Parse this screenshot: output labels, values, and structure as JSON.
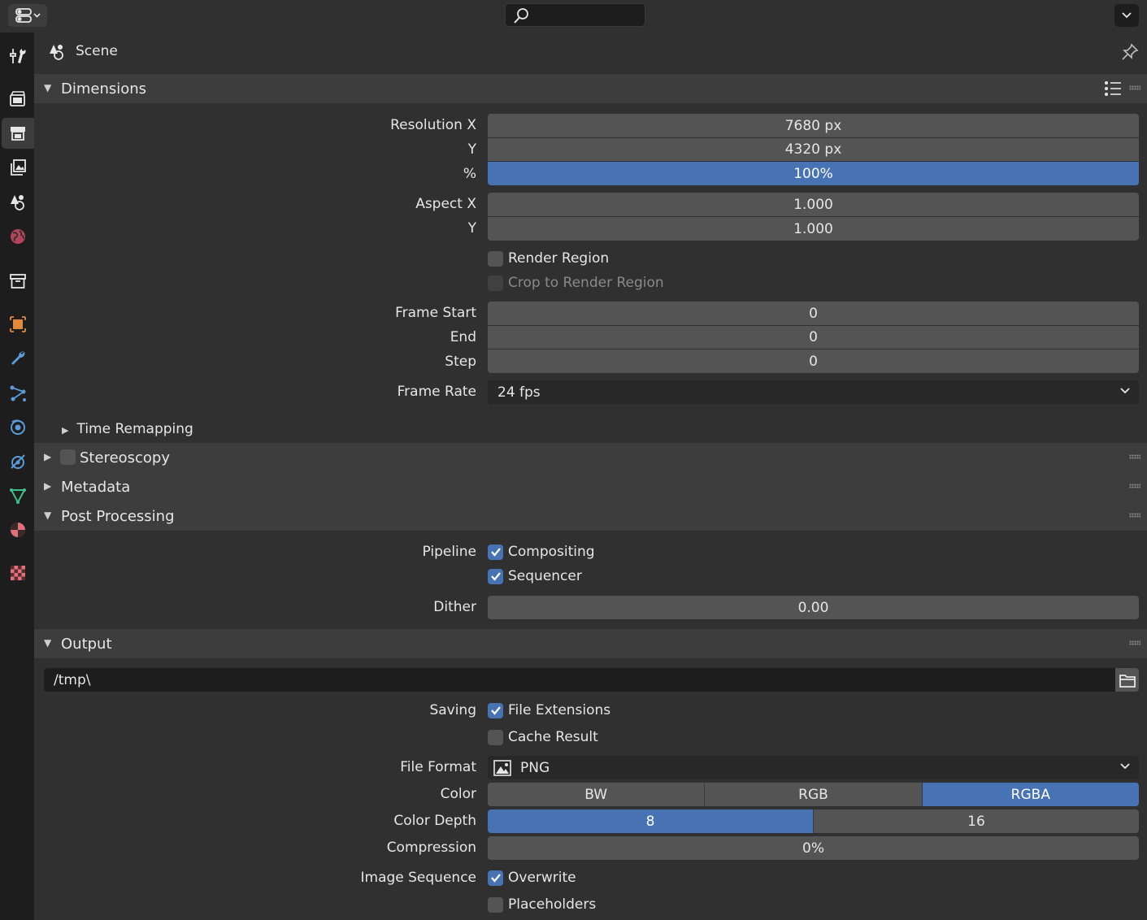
{
  "context": {
    "label": "Scene"
  },
  "panels": {
    "dimensions": {
      "title": "Dimensions",
      "resolution_x_label": "Resolution X",
      "resolution_x": "7680 px",
      "resolution_y_label": "Y",
      "resolution_y": "4320 px",
      "percent_label": "%",
      "percent": "100%",
      "aspect_x_label": "Aspect X",
      "aspect_x": "1.000",
      "aspect_y_label": "Y",
      "aspect_y": "1.000",
      "render_region": "Render Region",
      "crop_region": "Crop to Render Region",
      "frame_start_label": "Frame Start",
      "frame_start": "0",
      "frame_end_label": "End",
      "frame_end": "0",
      "frame_step_label": "Step",
      "frame_step": "0",
      "frame_rate_label": "Frame Rate",
      "frame_rate": "24 fps",
      "time_remapping": "Time Remapping"
    },
    "stereoscopy": {
      "title": "Stereoscopy"
    },
    "metadata": {
      "title": "Metadata"
    },
    "post_processing": {
      "title": "Post Processing",
      "pipeline_label": "Pipeline",
      "compositing": "Compositing",
      "sequencer": "Sequencer",
      "dither_label": "Dither",
      "dither": "0.00"
    },
    "output": {
      "title": "Output",
      "path": "/tmp\\",
      "saving_label": "Saving",
      "file_extensions": "File Extensions",
      "cache_result": "Cache Result",
      "file_format_label": "File Format",
      "file_format": "PNG",
      "color_label": "Color",
      "color_options": [
        "BW",
        "RGB",
        "RGBA"
      ],
      "color_depth_label": "Color Depth",
      "color_depth_options": [
        "8",
        "16"
      ],
      "compression_label": "Compression",
      "compression": "0%",
      "image_sequence_label": "Image Sequence",
      "overwrite": "Overwrite",
      "placeholders": "Placeholders"
    }
  },
  "tabs": [
    "tool-icon",
    "render-icon",
    "output-icon",
    "view-layer-icon",
    "scene-icon",
    "world-icon",
    "collection-icon",
    "object-icon",
    "modifier-icon",
    "particles-icon",
    "physics-icon",
    "constraints-icon",
    "data-icon",
    "material-icon",
    "texture-icon"
  ],
  "colors": {
    "accent": "#4772b3",
    "panel_header": "#3d3d3d",
    "background": "#303030",
    "field": "#545454"
  }
}
